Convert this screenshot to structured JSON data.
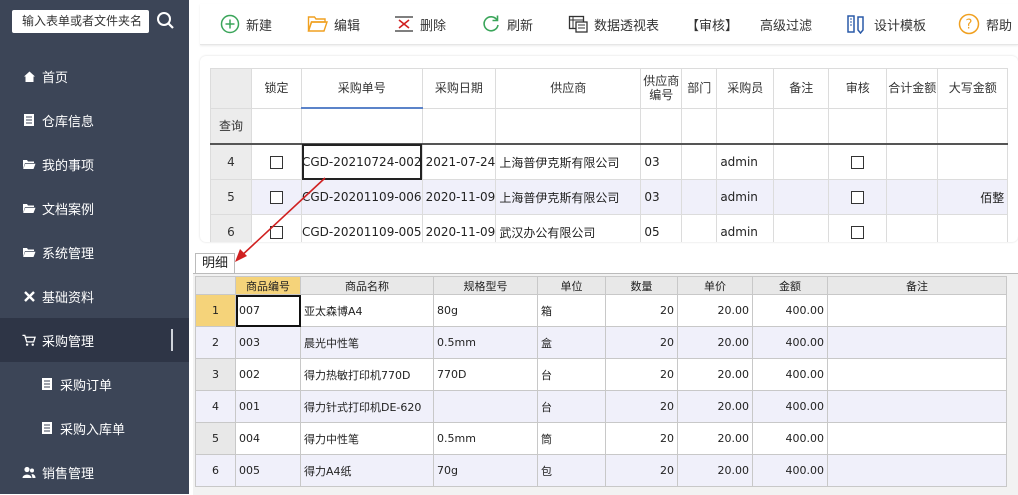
{
  "sidebar": {
    "search_placeholder": "输入表单或者文件夹名",
    "items": [
      {
        "label": "首页"
      },
      {
        "label": "仓库信息"
      },
      {
        "label": "我的事项"
      },
      {
        "label": "文档案例"
      },
      {
        "label": "系统管理"
      },
      {
        "label": "基础资料"
      },
      {
        "label": "采购管理"
      },
      {
        "label": "采购订单"
      },
      {
        "label": "采购入库单"
      },
      {
        "label": "销售管理"
      }
    ]
  },
  "toolbar": {
    "new": "新建",
    "edit": "编辑",
    "delete": "删除",
    "refresh": "刷新",
    "pivot": "数据透视表",
    "audit": "【审核】",
    "advanced_filter": "高级过滤",
    "design_template": "设计模板",
    "help": "帮助"
  },
  "orders": {
    "columns": [
      "锁定",
      "采购单号",
      "采购日期",
      "供应商",
      "供应商编号",
      "部门",
      "采购员",
      "备注",
      "审核",
      "合计金额",
      "大写金额"
    ],
    "query_label": "查询",
    "rows": [
      {
        "no": "4",
        "order": "CGD-20210724-002",
        "date": "2021-07-24",
        "supplier": "上海普伊克斯有限公司",
        "supplier_code": "03",
        "dept": "",
        "buyer": "admin",
        "note": "",
        "total": "",
        "upper": ""
      },
      {
        "no": "5",
        "order": "CGD-20201109-006",
        "date": "2020-11-09",
        "supplier": "上海普伊克斯有限公司",
        "supplier_code": "03",
        "dept": "",
        "buyer": "admin",
        "note": "",
        "total": "",
        "upper": "佰整"
      },
      {
        "no": "6",
        "order": "CGD-20201109-005",
        "date": "2020-11-09",
        "supplier": "武汉办公有限公司",
        "supplier_code": "05",
        "dept": "",
        "buyer": "admin",
        "note": "",
        "total": "",
        "upper": ""
      }
    ]
  },
  "detail": {
    "tab_label": "明细",
    "columns": [
      "商品编号",
      "商品名称",
      "规格型号",
      "单位",
      "数量",
      "单价",
      "金额",
      "备注"
    ],
    "rows": [
      {
        "no": "1",
        "code": "007",
        "name": "亚太森博A4",
        "spec": "80g",
        "unit": "箱",
        "qty": "20",
        "price": "20.00",
        "amount": "400.00",
        "note": ""
      },
      {
        "no": "2",
        "code": "003",
        "name": "晨光中性笔",
        "spec": "0.5mm",
        "unit": "盒",
        "qty": "20",
        "price": "20.00",
        "amount": "400.00",
        "note": ""
      },
      {
        "no": "3",
        "code": "002",
        "name": "得力热敏打印机770D",
        "spec": "770D",
        "unit": "台",
        "qty": "20",
        "price": "20.00",
        "amount": "400.00",
        "note": ""
      },
      {
        "no": "4",
        "code": "001",
        "name": "得力针式打印机DE-620",
        "spec": "",
        "unit": "台",
        "qty": "20",
        "price": "20.00",
        "amount": "400.00",
        "note": ""
      },
      {
        "no": "5",
        "code": "004",
        "name": "得力中性笔",
        "spec": "0.5mm",
        "unit": "筒",
        "qty": "20",
        "price": "20.00",
        "amount": "400.00",
        "note": ""
      },
      {
        "no": "6",
        "code": "005",
        "name": "得力A4纸",
        "spec": "70g",
        "unit": "包",
        "qty": "20",
        "price": "20.00",
        "amount": "400.00",
        "note": ""
      }
    ]
  },
  "colors": {
    "sidebar_bg": "#3c4557",
    "accent_green": "#3aa55a",
    "accent_orange": "#f0a020",
    "accent_red": "#d02020",
    "header_highlight": "#f5d37a"
  }
}
